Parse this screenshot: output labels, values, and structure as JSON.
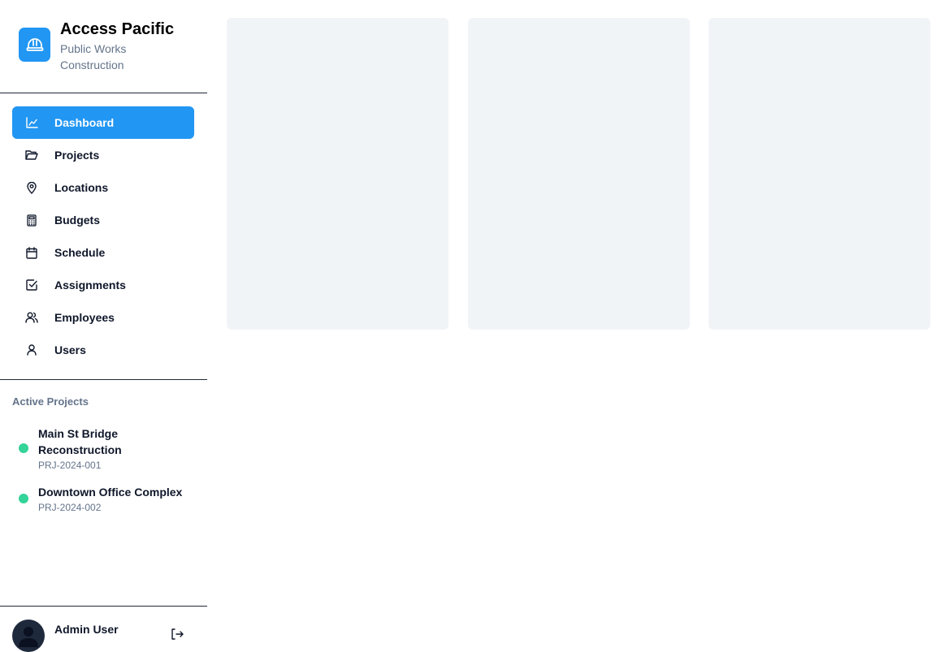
{
  "brand": {
    "title": "Access Pacific",
    "subtitle": "Public Works Construction",
    "logo_icon": "hard-hat-icon",
    "accent_color": "#2196f3"
  },
  "nav": {
    "items": [
      {
        "label": "Dashboard",
        "icon": "chart-line-icon",
        "active": true
      },
      {
        "label": "Projects",
        "icon": "folder-open-icon",
        "active": false
      },
      {
        "label": "Locations",
        "icon": "map-pin-icon",
        "active": false
      },
      {
        "label": "Budgets",
        "icon": "calculator-icon",
        "active": false
      },
      {
        "label": "Schedule",
        "icon": "calendar-icon",
        "active": false
      },
      {
        "label": "Assignments",
        "icon": "check-square-icon",
        "active": false
      },
      {
        "label": "Employees",
        "icon": "users-icon",
        "active": false
      },
      {
        "label": "Users",
        "icon": "user-icon",
        "active": false
      }
    ]
  },
  "active_projects": {
    "title": "Active Projects",
    "status_color": "#34d399",
    "items": [
      {
        "name": "Main St Bridge Reconstruction",
        "code": "PRJ-2024-001"
      },
      {
        "name": "Downtown Office Complex",
        "code": "PRJ-2024-002"
      }
    ]
  },
  "user": {
    "name": "Admin User",
    "logout_icon": "logout-icon"
  },
  "main": {
    "cards": [
      {
        "state": "loading-placeholder"
      },
      {
        "state": "loading-placeholder"
      },
      {
        "state": "loading-placeholder"
      }
    ]
  }
}
